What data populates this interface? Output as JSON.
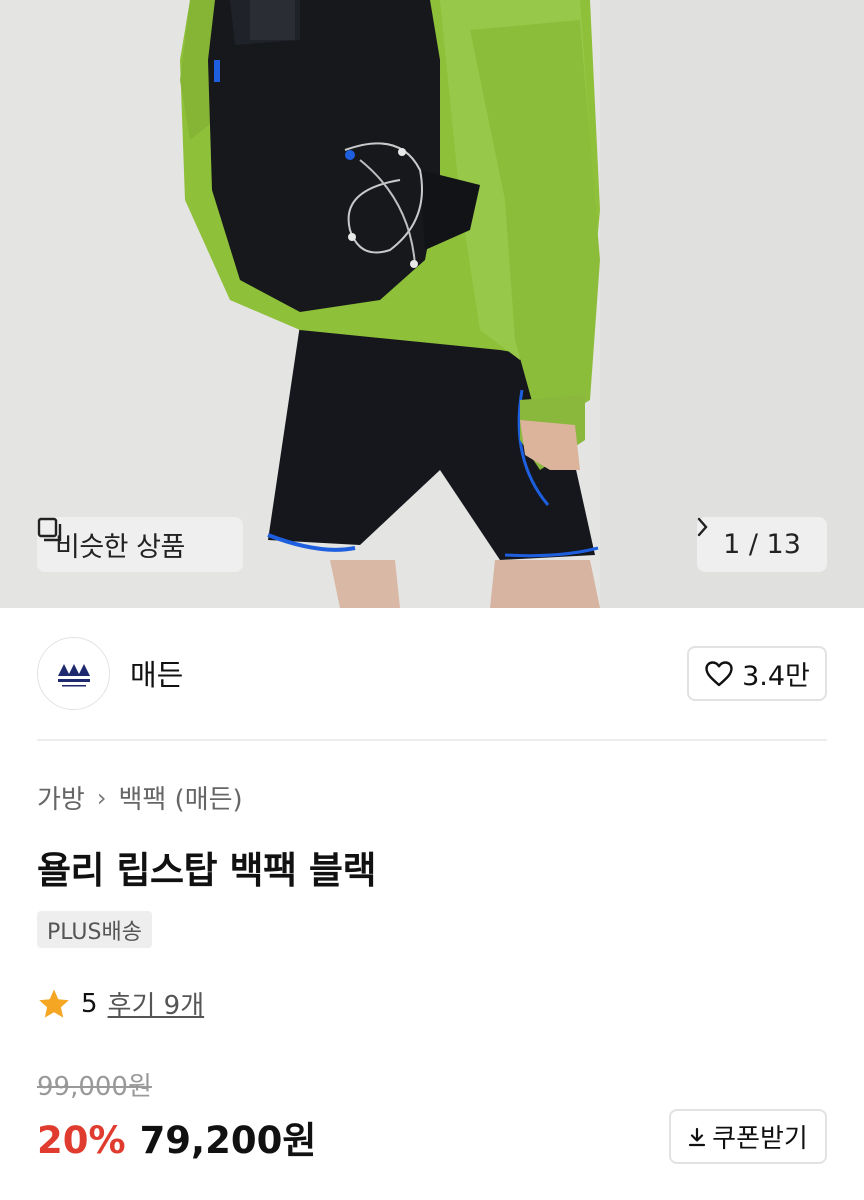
{
  "hero": {
    "similar_label": "비슷한 상품",
    "counter": "1 / 13"
  },
  "brand": {
    "name": "매든",
    "likes": "3.4만"
  },
  "product": {
    "breadcrumb": [
      "가방",
      "백팩 (매든)"
    ],
    "title": "욜리 립스탑 백팩 블랙",
    "badge": "PLUS배송",
    "rating": "5",
    "reviews": "후기 9개",
    "original_price": "99,000원",
    "discount": "20%",
    "price": "79,200원",
    "coupon_label": "쿠폰받기"
  },
  "colors": {
    "discount": "#e03b2f",
    "star": "#f5a623",
    "logo": "#1f2a6e"
  }
}
